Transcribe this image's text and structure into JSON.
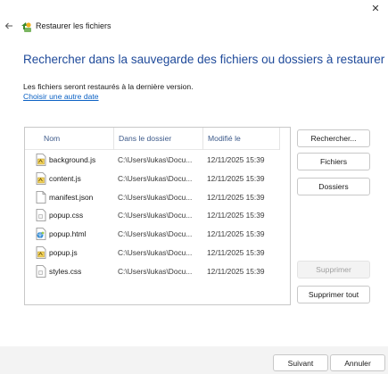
{
  "window": {
    "title": "Restaurer les fichiers",
    "close_glyph": "✕",
    "back_glyph": "←"
  },
  "main": {
    "heading": "Rechercher dans la sauvegarde des fichiers ou dossiers à restaurer",
    "info": "Les fichiers seront restaurés à la dernière version.",
    "choose_date_link": "Choisir une autre date"
  },
  "table": {
    "columns": [
      "Nom",
      "Dans le dossier",
      "Modifié le"
    ],
    "rows": [
      {
        "name": "background.js",
        "folder": "C:\\Users\\lukas\\Docu...",
        "modified": "12/11/2025 15:39",
        "icon": "js-file-icon"
      },
      {
        "name": "content.js",
        "folder": "C:\\Users\\lukas\\Docu...",
        "modified": "12/11/2025 15:39",
        "icon": "js-file-icon"
      },
      {
        "name": "manifest.json",
        "folder": "C:\\Users\\lukas\\Docu...",
        "modified": "12/11/2025 15:39",
        "icon": "blank-file-icon"
      },
      {
        "name": "popup.css",
        "folder": "C:\\Users\\lukas\\Docu...",
        "modified": "12/11/2025 15:39",
        "icon": "css-file-icon"
      },
      {
        "name": "popup.html",
        "folder": "C:\\Users\\lukas\\Docu...",
        "modified": "12/11/2025 15:39",
        "icon": "html-file-icon"
      },
      {
        "name": "popup.js",
        "folder": "C:\\Users\\lukas\\Docu...",
        "modified": "12/11/2025 15:39",
        "icon": "js-file-icon"
      },
      {
        "name": "styles.css",
        "folder": "C:\\Users\\lukas\\Docu...",
        "modified": "12/11/2025 15:39",
        "icon": "css-file-icon"
      }
    ]
  },
  "actions": {
    "search": "Rechercher...",
    "files": "Fichiers",
    "folders": "Dossiers",
    "remove": "Supprimer",
    "remove_all": "Supprimer tout"
  },
  "footer": {
    "next": "Suivant",
    "cancel": "Annuler"
  },
  "colors": {
    "heading": "#1f4a9a",
    "link": "#0b61c4",
    "footer_bg": "#f3f3f3"
  }
}
